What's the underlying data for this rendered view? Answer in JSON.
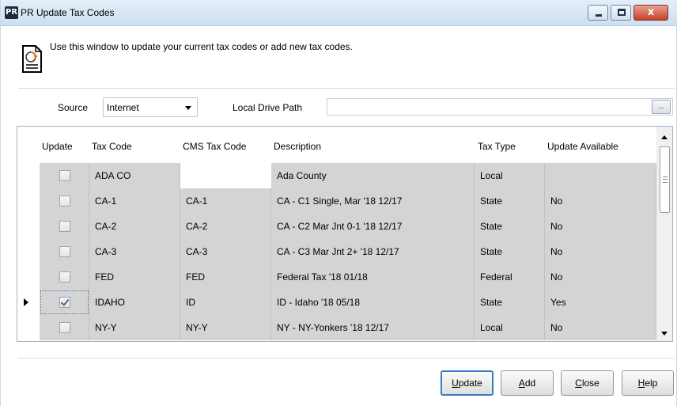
{
  "window": {
    "app_badge": "PR",
    "title": "PR Update Tax Codes",
    "close_glyph": "x"
  },
  "intro": {
    "icon": "document-update-icon",
    "text": "Use this window to update your current tax codes or add new tax codes."
  },
  "source": {
    "label": "Source",
    "selected": "Internet",
    "local_path_label": "Local Drive Path",
    "local_path_value": "",
    "browse_label": "..."
  },
  "grid": {
    "headers": {
      "update": "Update",
      "tax_code": "Tax Code",
      "cms_tax_code": "CMS Tax Code",
      "description": "Description",
      "tax_type": "Tax Type",
      "update_available": "Update Available"
    },
    "rows": [
      {
        "checked": false,
        "tax_code": "ADA CO",
        "cms_tax_code": "",
        "description": "Ada County",
        "tax_type": "Local",
        "update_available": "",
        "current": false
      },
      {
        "checked": false,
        "tax_code": "CA-1",
        "cms_tax_code": "CA-1",
        "description": "CA - C1  Single, Mar '18 12/17",
        "tax_type": "State",
        "update_available": "No",
        "current": false
      },
      {
        "checked": false,
        "tax_code": "CA-2",
        "cms_tax_code": "CA-2",
        "description": "CA - C2  Mar Jnt 0-1 '18 12/17",
        "tax_type": "State",
        "update_available": "No",
        "current": false
      },
      {
        "checked": false,
        "tax_code": "CA-3",
        "cms_tax_code": "CA-3",
        "description": "CA - C3  Mar Jnt 2+  '18 12/17",
        "tax_type": "State",
        "update_available": "No",
        "current": false
      },
      {
        "checked": false,
        "tax_code": "FED",
        "cms_tax_code": "FED",
        "description": "Federal Tax '18 01/18",
        "tax_type": "Federal",
        "update_available": "No",
        "current": false
      },
      {
        "checked": true,
        "tax_code": "IDAHO",
        "cms_tax_code": "ID",
        "description": "ID - Idaho '18 05/18",
        "tax_type": "State",
        "update_available": "Yes",
        "current": true
      },
      {
        "checked": false,
        "tax_code": "NY-Y",
        "cms_tax_code": "NY-Y",
        "description": "NY - NY-Yonkers '18 12/17",
        "tax_type": "Local",
        "update_available": "No",
        "current": false
      }
    ]
  },
  "buttons": {
    "update": {
      "mnemonic": "U",
      "rest": "pdate"
    },
    "add": {
      "mnemonic": "A",
      "rest": "dd"
    },
    "close": {
      "mnemonic": "C",
      "rest": "lose"
    },
    "help": {
      "mnemonic": "H",
      "rest": "elp"
    }
  }
}
